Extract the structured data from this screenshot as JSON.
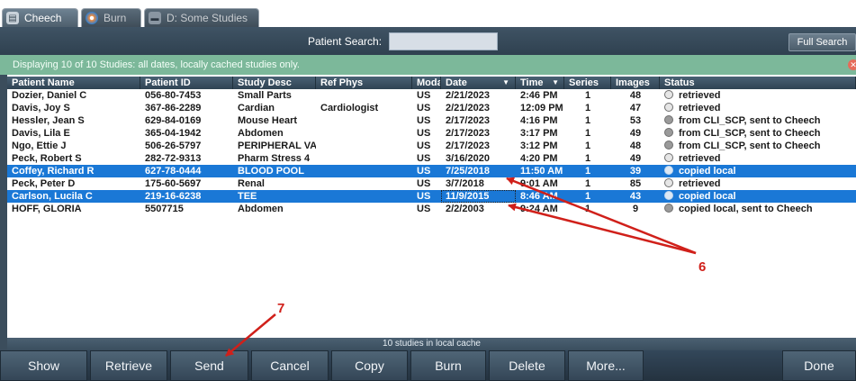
{
  "tabs": [
    {
      "label": "Cheech",
      "active": true,
      "icon": "cheech-icon"
    },
    {
      "label": "Burn",
      "active": false,
      "icon": "burn-disc-icon"
    },
    {
      "label": "D: Some Studies",
      "active": false,
      "icon": "drive-icon"
    }
  ],
  "search": {
    "label": "Patient Search:",
    "value": "",
    "full_search_label": "Full Search"
  },
  "info": {
    "text": "Displaying 10 of 10 Studies: all dates, locally cached studies only."
  },
  "columns": [
    "Patient Name",
    "Patient ID",
    "Study Desc",
    "Ref Phys",
    "Moda",
    "Date",
    "Time",
    "Series",
    "Images",
    "Status"
  ],
  "sort": {
    "date_indicator": "▼",
    "time_indicator": "▼"
  },
  "rows": [
    {
      "name": "Dozier, Daniel C",
      "id": "056-80-7453",
      "desc": "Small Parts",
      "ref": "",
      "mod": "US",
      "date": "2/21/2023",
      "time": "2:46 PM",
      "series": "1",
      "images": "48",
      "status": "retrieved",
      "status_icon": "circle",
      "selected": false
    },
    {
      "name": "Davis, Joy S",
      "id": "367-86-2289",
      "desc": "Cardian",
      "ref": "Cardiologist",
      "mod": "US",
      "date": "2/21/2023",
      "time": "12:09 PM",
      "series": "1",
      "images": "47",
      "status": "retrieved",
      "status_icon": "circle",
      "selected": false
    },
    {
      "name": "Hessler, Jean S",
      "id": "629-84-0169",
      "desc": "Mouse Heart",
      "ref": "",
      "mod": "US",
      "date": "2/17/2023",
      "time": "4:16 PM",
      "series": "1",
      "images": "53",
      "status": "from CLI_SCP, sent to Cheech",
      "status_icon": "share",
      "selected": false
    },
    {
      "name": "Davis, Lila E",
      "id": "365-04-1942",
      "desc": "Abdomen",
      "ref": "",
      "mod": "US",
      "date": "2/17/2023",
      "time": "3:17 PM",
      "series": "1",
      "images": "49",
      "status": "from CLI_SCP, sent to Cheech",
      "status_icon": "share",
      "selected": false
    },
    {
      "name": "Ngo, Ettie J",
      "id": "506-26-5797",
      "desc": "PERIPHERAL VA",
      "ref": "",
      "mod": "US",
      "date": "2/17/2023",
      "time": "3:12 PM",
      "series": "1",
      "images": "48",
      "status": "from CLI_SCP, sent to Cheech",
      "status_icon": "share",
      "selected": false
    },
    {
      "name": "Peck, Robert S",
      "id": "282-72-9313",
      "desc": "Pharm Stress 4",
      "ref": "",
      "mod": "US",
      "date": "3/16/2020",
      "time": "4:20 PM",
      "series": "1",
      "images": "49",
      "status": "retrieved",
      "status_icon": "circle",
      "selected": false
    },
    {
      "name": "Coffey, Richard R",
      "id": "627-78-0444",
      "desc": "BLOOD POOL",
      "ref": "",
      "mod": "US",
      "date": "7/25/2018",
      "time": "11:50 AM",
      "series": "1",
      "images": "39",
      "status": "copied local",
      "status_icon": "circle",
      "selected": true
    },
    {
      "name": "Peck, Peter D",
      "id": "175-60-5697",
      "desc": "Renal",
      "ref": "",
      "mod": "US",
      "date": "3/7/2018",
      "time": "9:01 AM",
      "series": "1",
      "images": "85",
      "status": "retrieved",
      "status_icon": "circle",
      "selected": false
    },
    {
      "name": "Carlson, Lucila C",
      "id": "219-16-6238",
      "desc": "TEE",
      "ref": "",
      "mod": "US",
      "date": "11/9/2015",
      "time": "8:46 AM",
      "series": "1",
      "images": "43",
      "status": "copied local",
      "status_icon": "circle",
      "selected": true
    },
    {
      "name": "HOFF, GLORIA",
      "id": "5507715",
      "desc": "Abdomen",
      "ref": "",
      "mod": "US",
      "date": "2/2/2003",
      "time": "9:24 AM",
      "series": "1",
      "images": "9",
      "status": "copied local, sent to Cheech",
      "status_icon": "share",
      "selected": false
    }
  ],
  "footer": {
    "status": "10 studies in local cache"
  },
  "buttons": [
    "Show",
    "Retrieve",
    "Send",
    "Cancel",
    "Copy",
    "Burn",
    "Delete",
    "More...",
    "Done"
  ],
  "annotations": {
    "callout_6": "6",
    "callout_7": "7",
    "arrow_color": "#d0201a"
  },
  "colors": {
    "selection": "#1a78d6",
    "banner": "#7cb89a",
    "chrome": "#3b4d5c"
  }
}
